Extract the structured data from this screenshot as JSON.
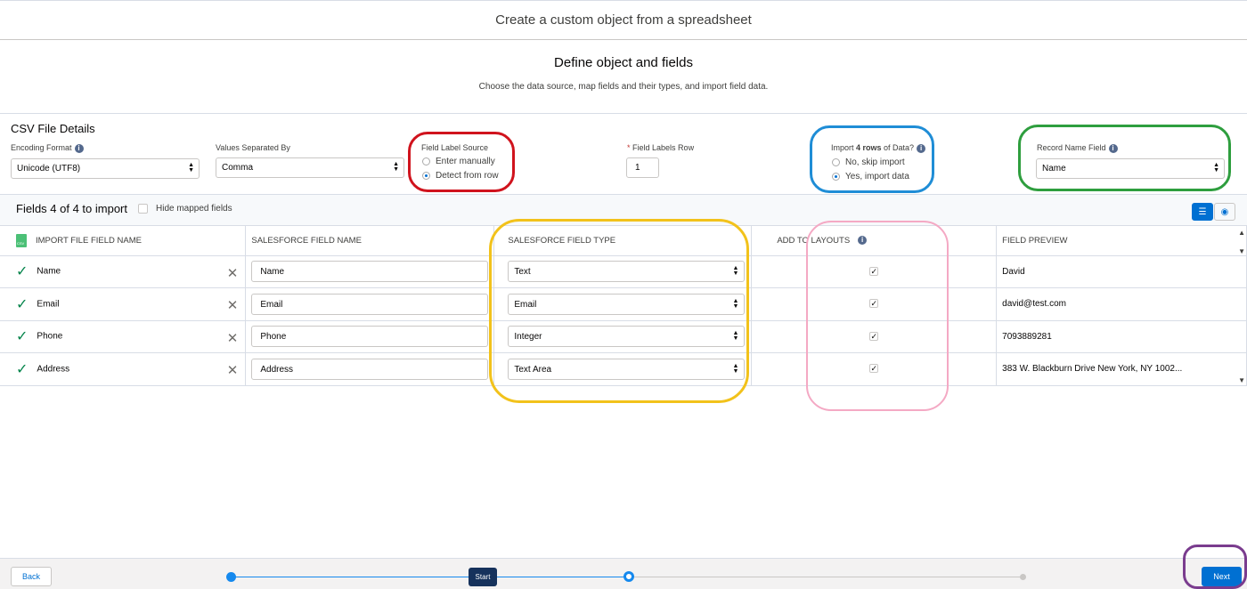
{
  "modal": {
    "title": "Create a custom object from a spreadsheet"
  },
  "section": {
    "title": "Define object and fields",
    "subtitle": "Choose the data source, map fields and their types, and import field data."
  },
  "csv": {
    "title": "CSV File Details",
    "encoding": {
      "label": "Encoding Format",
      "value": "Unicode (UTF8)"
    },
    "separator": {
      "label": "Values Separated By",
      "value": "Comma"
    },
    "label_source": {
      "label": "Field Label Source",
      "options": [
        "Enter manually",
        "Detect from row"
      ],
      "selected": "Detect from row"
    },
    "labels_row": {
      "label": "Field Labels Row",
      "required_mark": "*",
      "value": "1"
    },
    "import_rows": {
      "label_pre": "Import ",
      "label_bold": "4 rows",
      "label_post": " of Data?",
      "options": [
        "No, skip import",
        "Yes, import data"
      ],
      "selected": "Yes, import data"
    },
    "record_name": {
      "label": "Record Name Field",
      "value": "Name"
    }
  },
  "fields": {
    "title": "Fields 4 of 4 to import",
    "hide_mapped_label": "Hide mapped fields",
    "headers": [
      "IMPORT FILE FIELD NAME",
      "SALESFORCE FIELD NAME",
      "SALESFORCE FIELD TYPE",
      "ADD TO LAYOUTS",
      "FIELD PREVIEW"
    ],
    "rows": [
      {
        "import_name": "Name",
        "sf_name": "Name",
        "sf_type": "Text",
        "add_to_layout": true,
        "preview": "David"
      },
      {
        "import_name": "Email",
        "sf_name": "Email",
        "sf_type": "Email",
        "add_to_layout": true,
        "preview": "david@test.com"
      },
      {
        "import_name": "Phone",
        "sf_name": "Phone",
        "sf_type": "Integer",
        "add_to_layout": true,
        "preview": "7093889281"
      },
      {
        "import_name": "Address",
        "sf_name": "Address",
        "sf_type": "Text Area",
        "add_to_layout": true,
        "preview": "383 W. Blackburn Drive New York, NY 1002..."
      }
    ]
  },
  "footer": {
    "back_label": "Back",
    "next_label": "Next",
    "progress_tooltip": "Start"
  },
  "colors": {
    "brand": "#0070d2",
    "check_green": "#04844b",
    "annotation_red": "#d0131d",
    "annotation_blue": "#1f8dd6",
    "annotation_green": "#2e9e3e",
    "annotation_yellow": "#f2c21b",
    "annotation_pink": "#f4a9c4",
    "annotation_purple": "#7a3c8e"
  }
}
